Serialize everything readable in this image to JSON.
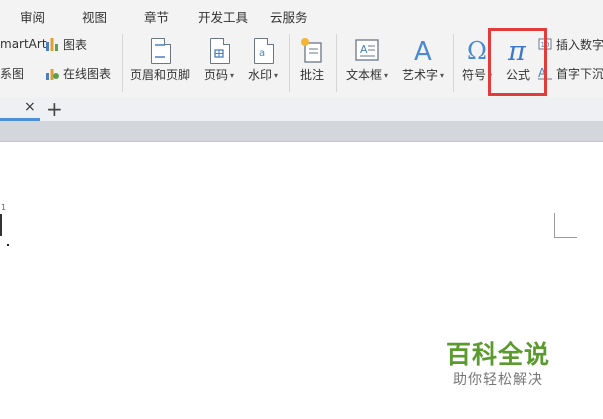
{
  "tabs": [
    "审阅",
    "视图",
    "章节",
    "开发工具",
    "云服务"
  ],
  "ribbon": {
    "smartart_label": "martArt",
    "chart_label": "图表",
    "relation_label": "系图",
    "online_chart_label": "在线图表",
    "header_footer_label": "页眉和页脚",
    "page_number_label": "页码",
    "watermark_label": "水印",
    "comment_label": "批注",
    "textbox_label": "文本框",
    "wordart_label": "艺术字",
    "symbol_label": "符号",
    "formula_label": "公式",
    "insert_number_label": "插入数字",
    "dropcap_label": "首字下沉",
    "caret": "▾"
  },
  "doc_tab": {
    "close_glyph": "×",
    "add_glyph": "+"
  },
  "page": {
    "page_number": "1"
  },
  "watermark": {
    "main": "百科全说",
    "sub": "助你轻松解决"
  },
  "colors": {
    "highlight": "#e23b3b",
    "watermark": "#5a9a2e",
    "accent": "#4d8fd8"
  }
}
